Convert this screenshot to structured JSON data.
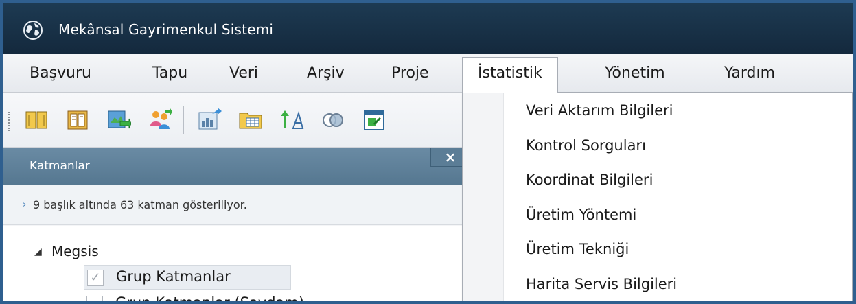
{
  "window": {
    "title": "Mekânsal Gayrimenkul Sistemi"
  },
  "menubar": {
    "items": [
      {
        "label": "Başvuru"
      },
      {
        "label": "Tapu"
      },
      {
        "label": "Veri"
      },
      {
        "label": "Arşiv"
      },
      {
        "label": "Proje"
      },
      {
        "label": "İstatistik"
      },
      {
        "label": "Yönetim"
      },
      {
        "label": "Yardım"
      }
    ],
    "active": "İstatistik"
  },
  "toolbar": {
    "icons": [
      "book-icon",
      "open-book-icon",
      "map-export-icon",
      "users-icon",
      "chart-export-icon",
      "folder-table-icon",
      "sort-icon",
      "overlay-circles-icon",
      "window-icon"
    ]
  },
  "dropdown": {
    "items": [
      {
        "label": "Veri Aktarım Bilgileri"
      },
      {
        "label": "Kontrol Sorguları"
      },
      {
        "label": "Koordinat Bilgileri"
      },
      {
        "label": "Üretim Yöntemi"
      },
      {
        "label": "Üretim Tekniği"
      },
      {
        "label": "Harita Servis Bilgileri"
      }
    ]
  },
  "layers_panel": {
    "title": "Katmanlar",
    "close_glyph": "×",
    "info": "9 başlık altında 63 katman gösteriliyor.",
    "info_chevron": "›",
    "tree": {
      "root_caret": "◢",
      "root_label": "Megsis",
      "children": [
        {
          "label": "Grup Katmanlar",
          "checked": true,
          "check_glyph": "✓"
        },
        {
          "label": "Grup Katmanlar (Saydam)",
          "checked": false
        }
      ]
    }
  },
  "colors": {
    "titlebar": "#1d3a52",
    "frame_border": "#2f5f8f",
    "panel_header": "#6a8ba4",
    "info_chevron": "#3a78b5"
  }
}
